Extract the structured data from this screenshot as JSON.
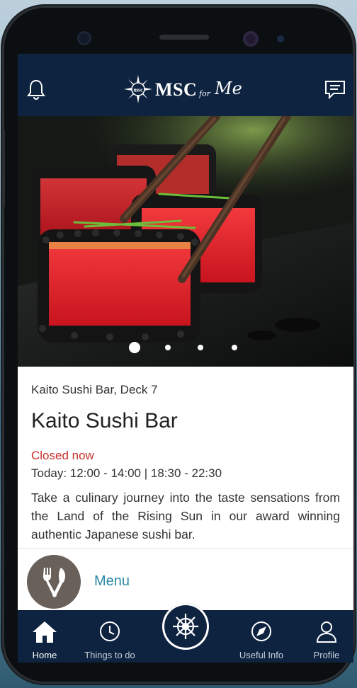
{
  "app": {
    "brand": "MSC",
    "brand_for": "for",
    "brand_me": "Me"
  },
  "carousel": {
    "slide_count": 4,
    "active_index": 0
  },
  "venue": {
    "location": "Kaito Sushi Bar, Deck 7",
    "title": "Kaito Sushi Bar",
    "status": "Closed now",
    "hours": "Today:  12:00 - 14:00  |  18:30 - 22:30",
    "description": "Take a culinary journey into the taste sensations from the Land of the Rising Sun in our award winning authentic Japanese sushi bar.",
    "menu_label": "Menu"
  },
  "nav": {
    "items": [
      {
        "label": "Home",
        "icon": "home-icon",
        "active": true
      },
      {
        "label": "Things to do",
        "icon": "clock-icon",
        "active": false
      },
      {
        "label": "",
        "icon": "helm-icon",
        "active": false
      },
      {
        "label": "Useful Info",
        "icon": "compass-icon",
        "active": false
      },
      {
        "label": "Profile",
        "icon": "profile-icon",
        "active": false
      }
    ]
  },
  "colors": {
    "navy": "#0e2340",
    "closed_red": "#c9302c",
    "menu_teal": "#2a8aa4"
  }
}
